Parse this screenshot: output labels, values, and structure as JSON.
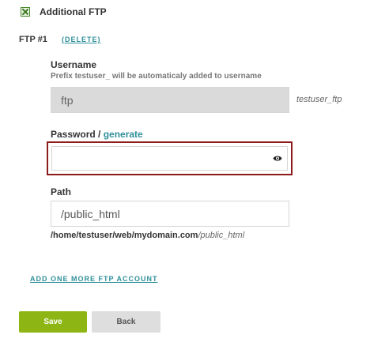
{
  "additional_ftp": {
    "label": "Additional FTP",
    "checked": true
  },
  "ftp_entry": {
    "title": "FTP #1",
    "delete_label": "(DELETE)",
    "username": {
      "label": "Username",
      "hint": "Prefix testuser_ will be automaticaly added to username",
      "value": "ftp",
      "suffix": "testuser_ftp"
    },
    "password": {
      "label": "Password /",
      "generate_label": "generate",
      "value": "",
      "eye_icon": "eye-icon"
    },
    "path": {
      "label": "Path",
      "value": "/public_html",
      "base": "/home/testuser/web/mydomain.com",
      "rest": "/public_html"
    }
  },
  "add_more_label": "ADD ONE MORE FTP ACCOUNT",
  "buttons": {
    "save": "Save",
    "back": "Back"
  },
  "colors": {
    "accent_link": "#2f8f9a",
    "save_bg": "#8db615",
    "focus_border": "#8e1b1b"
  }
}
